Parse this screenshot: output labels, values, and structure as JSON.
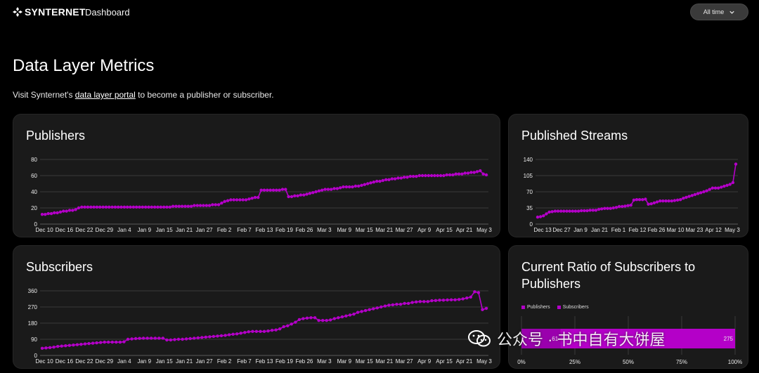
{
  "header": {
    "brand": "SYNTERNET",
    "nav_dashboard": "Dashboard",
    "range_button": "All time"
  },
  "page": {
    "title": "Data Layer Metrics",
    "subtitle_prefix": "Visit Synternet's ",
    "subtitle_link": "data layer portal",
    "subtitle_suffix": " to become a publisher or subscriber."
  },
  "colors": {
    "accent": "#b400c8",
    "card": "#1a1a1a",
    "background": "#000000"
  },
  "watermark": "公众号 · 书中自有大饼屋",
  "chart_data": [
    {
      "id": "publishers",
      "type": "line",
      "title": "Publishers",
      "ylim": [
        0,
        80
      ],
      "yticks": [
        0,
        20,
        40,
        60,
        80
      ],
      "xticks": [
        "Dec 10",
        "Dec 16",
        "Dec 22",
        "Dec 29",
        "Jan 4",
        "Jan 9",
        "Jan 15",
        "Jan 21",
        "Jan 27",
        "Feb 2",
        "Feb 7",
        "Feb 13",
        "Feb 19",
        "Feb 26",
        "Mar 3",
        "Mar 9",
        "Mar 15",
        "Mar 21",
        "Mar 27",
        "Apr 9",
        "Apr 15",
        "Apr 21",
        "May 3"
      ],
      "y": [
        12,
        12,
        13,
        13,
        14,
        14,
        15,
        16,
        16,
        17,
        17,
        18,
        20,
        21,
        21,
        21,
        21,
        21,
        21,
        21,
        21,
        21,
        21,
        21,
        21,
        21,
        21,
        21,
        21,
        21,
        21,
        21,
        21,
        21,
        21,
        21,
        21,
        21,
        21,
        21,
        21,
        21,
        21,
        22,
        22,
        22,
        22,
        22,
        22,
        22,
        23,
        23,
        23,
        23,
        23,
        23,
        24,
        24,
        24,
        26,
        28,
        29,
        30,
        30,
        30,
        30,
        30,
        30,
        31,
        32,
        33,
        33,
        42,
        42,
        42,
        42,
        42,
        42,
        42,
        43,
        43,
        34,
        34,
        35,
        35,
        36,
        36,
        37,
        38,
        39,
        40,
        41,
        42,
        43,
        43,
        43,
        44,
        44,
        45,
        46,
        46,
        46,
        46,
        47,
        47,
        48,
        49,
        50,
        51,
        52,
        53,
        53,
        54,
        55,
        55,
        56,
        56,
        57,
        57,
        58,
        58,
        59,
        59,
        59,
        60,
        60,
        60,
        60,
        60,
        60,
        60,
        60,
        60,
        61,
        61,
        61,
        62,
        62,
        62,
        63,
        63,
        64,
        64,
        65,
        66,
        62,
        61
      ]
    },
    {
      "id": "streams",
      "type": "line",
      "title": "Published Streams",
      "ylim": [
        0,
        140
      ],
      "yticks": [
        0,
        35,
        70,
        105,
        140
      ],
      "xticks": [
        "Dec 13",
        "Dec 27",
        "Jan 9",
        "Jan 21",
        "Feb 1",
        "Feb 12",
        "Feb 26",
        "Mar 10",
        "Mar 23",
        "Apr 12",
        "May 3"
      ],
      "y": [
        15,
        16,
        18,
        22,
        26,
        27,
        28,
        28,
        28,
        28,
        28,
        28,
        28,
        28,
        28,
        29,
        29,
        29,
        30,
        30,
        30,
        32,
        33,
        34,
        34,
        34,
        35,
        36,
        38,
        38,
        39,
        40,
        41,
        52,
        53,
        53,
        53,
        54,
        43,
        44,
        46,
        48,
        50,
        50,
        50,
        50,
        50,
        51,
        52,
        53,
        56,
        58,
        60,
        62,
        64,
        66,
        68,
        70,
        72,
        75,
        78,
        78,
        78,
        80,
        82,
        84,
        86,
        90,
        130
      ]
    },
    {
      "id": "subscribers",
      "type": "line",
      "title": "Subscribers",
      "ylim": [
        0,
        360
      ],
      "yticks": [
        0,
        90,
        180,
        270,
        360
      ],
      "xticks": [
        "Dec 10",
        "Dec 16",
        "Dec 22",
        "Dec 29",
        "Jan 4",
        "Jan 9",
        "Jan 15",
        "Jan 21",
        "Jan 27",
        "Feb 2",
        "Feb 7",
        "Feb 13",
        "Feb 19",
        "Feb 26",
        "Mar 3",
        "Mar 9",
        "Mar 15",
        "Mar 21",
        "Mar 27",
        "Apr 9",
        "Apr 15",
        "Apr 21",
        "May 3"
      ],
      "y": [
        40,
        42,
        44,
        46,
        50,
        52,
        54,
        56,
        58,
        60,
        62,
        64,
        66,
        68,
        70,
        72,
        74,
        74,
        74,
        74,
        74,
        76,
        90,
        92,
        94,
        95,
        96,
        96,
        96,
        96,
        96,
        96,
        86,
        86,
        88,
        90,
        90,
        92,
        94,
        96,
        98,
        100,
        102,
        104,
        106,
        108,
        110,
        112,
        115,
        118,
        120,
        124,
        128,
        132,
        134,
        134,
        134,
        134,
        136,
        140,
        142,
        148,
        160,
        165,
        175,
        185,
        200,
        205,
        208,
        210,
        210,
        195,
        195,
        195,
        198,
        205,
        210,
        215,
        220,
        225,
        230,
        240,
        245,
        250,
        255,
        260,
        265,
        270,
        275,
        280,
        282,
        285,
        285,
        290,
        290,
        295,
        298,
        300,
        300,
        300,
        305,
        306,
        308,
        308,
        309,
        310,
        310,
        312,
        315,
        320,
        325,
        355,
        350,
        255,
        262
      ]
    },
    {
      "id": "ratio",
      "type": "bar",
      "title": "Current Ratio of Subscribers to Publishers",
      "series": [
        {
          "name": "Publishers",
          "values": [
            61
          ]
        },
        {
          "name": "Subscribers",
          "values": [
            275
          ]
        }
      ],
      "xticks": [
        "0%",
        "25%",
        "50%",
        "75%",
        "100%"
      ],
      "data_labels": [
        "61",
        "275"
      ]
    }
  ]
}
